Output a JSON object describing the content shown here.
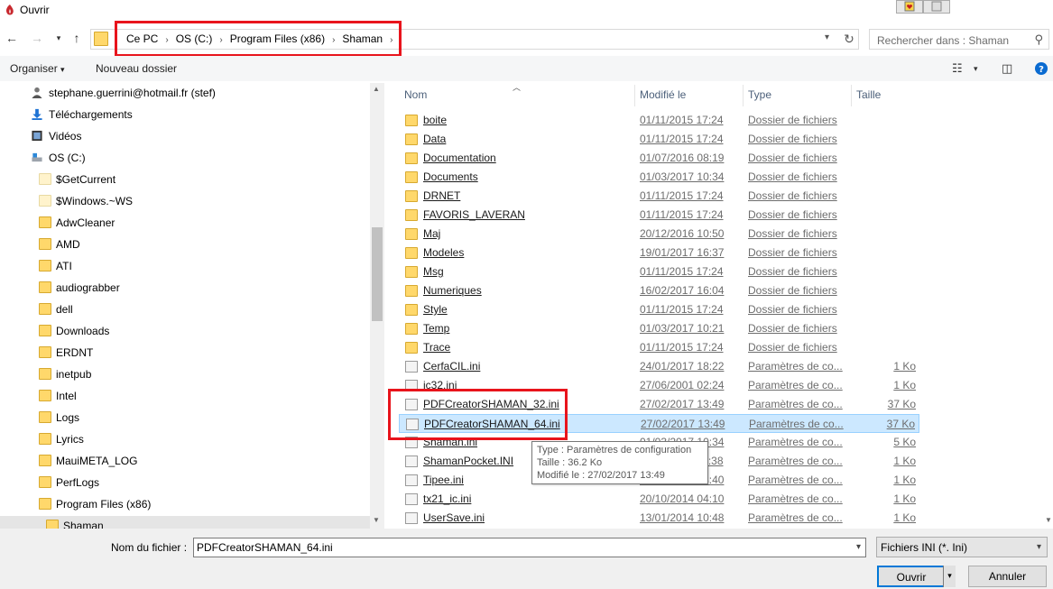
{
  "window": {
    "title": "Ouvrir"
  },
  "address": {
    "crumbs": [
      "Ce PC",
      "OS (C:)",
      "Program Files (x86)",
      "Shaman"
    ],
    "search_placeholder": "Rechercher dans : Shaman"
  },
  "toolbar": {
    "organize": "Organiser",
    "new_folder": "Nouveau dossier"
  },
  "nav": {
    "items": [
      {
        "label": "stephane.guerrini@hotmail.fr (stef)",
        "icon": "user-icon"
      },
      {
        "label": "Téléchargements",
        "icon": "download-icon"
      },
      {
        "label": "Vidéos",
        "icon": "video-icon"
      },
      {
        "label": "OS (C:)",
        "icon": "drive-icon"
      },
      {
        "label": "$GetCurrent",
        "icon": "folder-icon"
      },
      {
        "label": "$Windows.~WS",
        "icon": "folder-icon"
      },
      {
        "label": "AdwCleaner",
        "icon": "folder-icon"
      },
      {
        "label": "AMD",
        "icon": "folder-icon"
      },
      {
        "label": "ATI",
        "icon": "folder-icon"
      },
      {
        "label": "audiograbber",
        "icon": "folder-icon"
      },
      {
        "label": "dell",
        "icon": "folder-icon"
      },
      {
        "label": "Downloads",
        "icon": "folder-icon"
      },
      {
        "label": "ERDNT",
        "icon": "folder-icon"
      },
      {
        "label": "inetpub",
        "icon": "folder-icon"
      },
      {
        "label": "Intel",
        "icon": "folder-icon"
      },
      {
        "label": "Logs",
        "icon": "folder-icon"
      },
      {
        "label": "Lyrics",
        "icon": "folder-icon"
      },
      {
        "label": "MauiMETA_LOG",
        "icon": "folder-icon"
      },
      {
        "label": "PerfLogs",
        "icon": "folder-icon"
      },
      {
        "label": "Program Files (x86)",
        "icon": "folder-icon"
      },
      {
        "label": "Shaman",
        "icon": "folder-icon"
      }
    ]
  },
  "list": {
    "columns": {
      "name": "Nom",
      "modified": "Modifié le",
      "type": "Type",
      "size": "Taille"
    },
    "rows": [
      {
        "name": "boite",
        "date": "01/11/2015 17:24",
        "type": "Dossier de fichiers",
        "size": "",
        "kind": "folder"
      },
      {
        "name": "Data",
        "date": "01/11/2015 17:24",
        "type": "Dossier de fichiers",
        "size": "",
        "kind": "folder"
      },
      {
        "name": "Documentation",
        "date": "01/07/2016 08:19",
        "type": "Dossier de fichiers",
        "size": "",
        "kind": "folder"
      },
      {
        "name": "Documents",
        "date": "01/03/2017 10:34",
        "type": "Dossier de fichiers",
        "size": "",
        "kind": "folder"
      },
      {
        "name": "DRNET",
        "date": "01/11/2015 17:24",
        "type": "Dossier de fichiers",
        "size": "",
        "kind": "folder"
      },
      {
        "name": "FAVORIS_LAVERAN",
        "date": "01/11/2015 17:24",
        "type": "Dossier de fichiers",
        "size": "",
        "kind": "folder"
      },
      {
        "name": "Maj",
        "date": "20/12/2016 10:50",
        "type": "Dossier de fichiers",
        "size": "",
        "kind": "folder"
      },
      {
        "name": "Modeles",
        "date": "19/01/2017 16:37",
        "type": "Dossier de fichiers",
        "size": "",
        "kind": "folder"
      },
      {
        "name": "Msg",
        "date": "01/11/2015 17:24",
        "type": "Dossier de fichiers",
        "size": "",
        "kind": "folder"
      },
      {
        "name": "Numeriques",
        "date": "16/02/2017 16:04",
        "type": "Dossier de fichiers",
        "size": "",
        "kind": "folder"
      },
      {
        "name": "Style",
        "date": "01/11/2015 17:24",
        "type": "Dossier de fichiers",
        "size": "",
        "kind": "folder"
      },
      {
        "name": "Temp",
        "date": "01/03/2017 10:21",
        "type": "Dossier de fichiers",
        "size": "",
        "kind": "folder"
      },
      {
        "name": "Trace",
        "date": "01/11/2015 17:24",
        "type": "Dossier de fichiers",
        "size": "",
        "kind": "folder"
      },
      {
        "name": "CerfaCIL.ini",
        "date": "24/01/2017 18:22",
        "type": "Paramètres de co...",
        "size": "1 Ko",
        "kind": "ini"
      },
      {
        "name": "ic32.ini",
        "date": "27/06/2001 02:24",
        "type": "Paramètres de co...",
        "size": "1 Ko",
        "kind": "ini"
      },
      {
        "name": "PDFCreatorSHAMAN_32.ini",
        "date": "27/02/2017 13:49",
        "type": "Paramètres de co...",
        "size": "37 Ko",
        "kind": "ini"
      },
      {
        "name": "PDFCreatorSHAMAN_64.ini",
        "date": "27/02/2017 13:49",
        "type": "Paramètres de co...",
        "size": "37 Ko",
        "kind": "ini",
        "selected": true
      },
      {
        "name": "Shaman.ini",
        "date": "01/03/2017 10:34",
        "type": "Paramètres de co...",
        "size": "5 Ko",
        "kind": "ini"
      },
      {
        "name": "ShamanPocket.INI",
        "date": "28/02/2017 11:38",
        "type": "Paramètres de co...",
        "size": "1 Ko",
        "kind": "ini"
      },
      {
        "name": "Tipee.ini",
        "date": "19/01/2017 13:40",
        "type": "Paramètres de co...",
        "size": "1 Ko",
        "kind": "ini"
      },
      {
        "name": "tx21_ic.ini",
        "date": "20/10/2014 04:10",
        "type": "Paramètres de co...",
        "size": "1 Ko",
        "kind": "ini"
      },
      {
        "name": "UserSave.ini",
        "date": "13/01/2014 10:48",
        "type": "Paramètres de co...",
        "size": "1 Ko",
        "kind": "ini"
      }
    ]
  },
  "tooltip": {
    "type": "Type : Paramètres de configuration",
    "size": "Taille : 36.2 Ko",
    "modified": "Modifié le : 27/02/2017 13:49"
  },
  "bottom": {
    "filename_label": "Nom du fichier :",
    "filename_value": "PDFCreatorSHAMAN_64.ini",
    "filetype": "Fichiers INI (*. Ini)",
    "open": "Ouvrir",
    "cancel": "Annuler"
  },
  "colors": {
    "highlight": "#e8141c",
    "selection": "#cce8ff",
    "folder": "#ffd86b"
  }
}
